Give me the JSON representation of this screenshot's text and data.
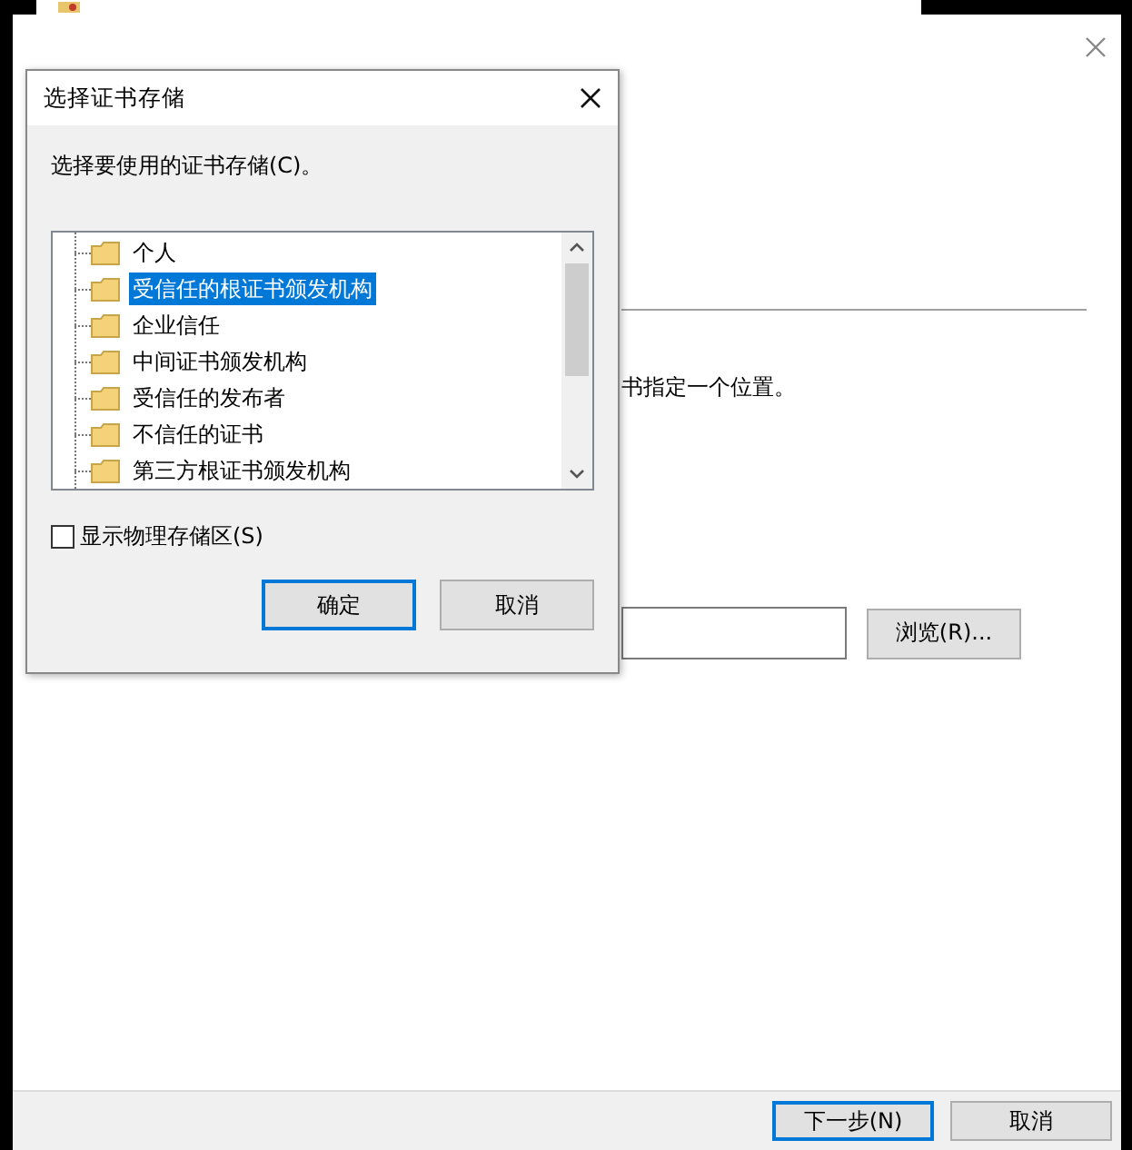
{
  "wizard": {
    "instruction_fragment": "书指定一个位置。",
    "browse_button": "浏览(R)...",
    "buttons": [
      {
        "label": "下一步(N)",
        "default": true
      },
      {
        "label": "取消",
        "default": false
      }
    ]
  },
  "dialog": {
    "title": "选择证书存储",
    "prompt": "选择要使用的证书存储(C)。",
    "stores": [
      {
        "label": "个人",
        "selected": false
      },
      {
        "label": "受信任的根证书颁发机构",
        "selected": true
      },
      {
        "label": "企业信任",
        "selected": false
      },
      {
        "label": "中间证书颁发机构",
        "selected": false
      },
      {
        "label": "受信任的发布者",
        "selected": false
      },
      {
        "label": "不信任的证书",
        "selected": false
      },
      {
        "label": "第三方根证书颁发机构",
        "selected": false
      }
    ],
    "show_physical": {
      "label": "显示物理存储区(S)",
      "checked": false
    },
    "buttons": [
      {
        "label": "确定",
        "default": true
      },
      {
        "label": "取消",
        "default": false
      }
    ]
  }
}
